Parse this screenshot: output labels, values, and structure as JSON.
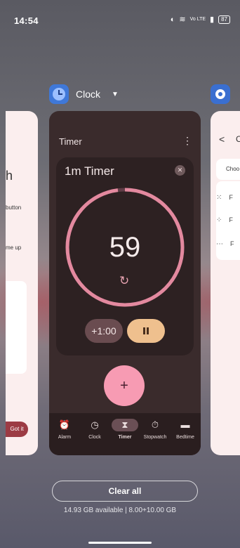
{
  "status_bar": {
    "time": "14:54",
    "network_label": "Vo LTE",
    "battery": "87"
  },
  "recent_apps": {
    "current_app": {
      "name": "Clock",
      "icon": "clock-app-icon"
    },
    "next_app": {
      "icon": "settings-gear-icon"
    }
  },
  "left_card": {
    "heading": "h",
    "line1": "button",
    "line2": "me up",
    "action": "Got it"
  },
  "right_card": {
    "letter": "C",
    "choose": "Choo",
    "rows": [
      "F",
      "F",
      "F"
    ]
  },
  "clock_card": {
    "title": "Timer",
    "timer": {
      "label": "1m Timer",
      "value": "59",
      "progress": 0.98,
      "add_label": "+1:00"
    },
    "fab_label": "+",
    "nav": [
      {
        "label": "Alarm",
        "icon": "alarm-icon",
        "glyph": "⏰"
      },
      {
        "label": "Clock",
        "icon": "clock-icon",
        "glyph": "◷"
      },
      {
        "label": "Timer",
        "icon": "hourglass-icon",
        "glyph": "⧗",
        "active": true
      },
      {
        "label": "Stopwatch",
        "icon": "stopwatch-icon",
        "glyph": "⏱"
      },
      {
        "label": "Bedtime",
        "icon": "bed-icon",
        "glyph": "▬"
      }
    ]
  },
  "footer": {
    "clear_all": "Clear all",
    "memory": "14.93 GB available | 8.00+10.00 GB"
  },
  "colors": {
    "ring_track": "#5f3c46",
    "ring_progress": "#e3899f",
    "accent_pink": "#f79bb3",
    "pause_bg": "#efc08e"
  }
}
